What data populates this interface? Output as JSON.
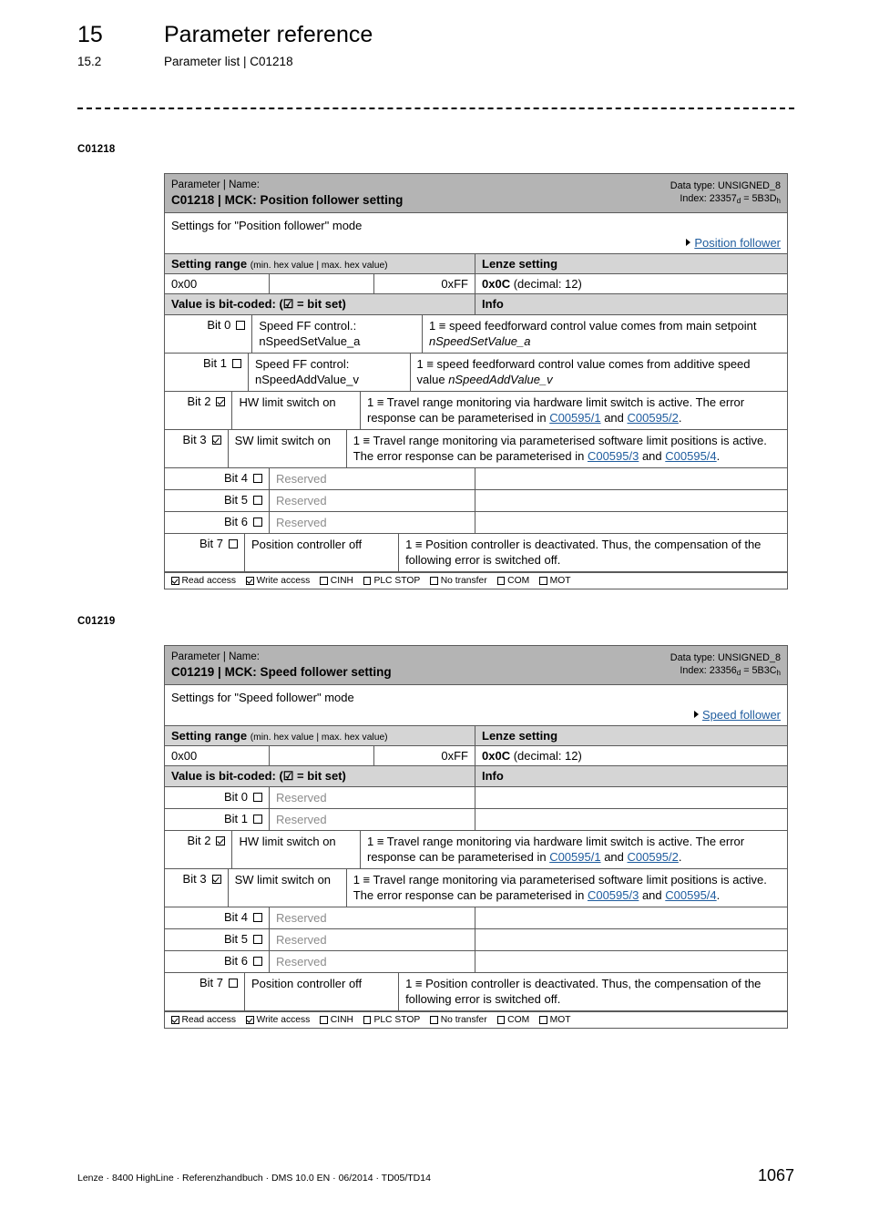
{
  "header": {
    "chapter_number": "15",
    "chapter_title": "Parameter reference",
    "section_number": "15.2",
    "section_title": "Parameter list | C01218"
  },
  "side_labels": {
    "first": "C01218",
    "second": "C01219"
  },
  "footer": {
    "left": "Lenze · 8400 HighLine · Referenzhandbuch · DMS 10.0 EN · 06/2014 · TD05/TD14",
    "page": "1067"
  },
  "common": {
    "kicker": "Parameter | Name:",
    "setting_range_label": "Setting range",
    "setting_range_sub": "(min. hex value | max. hex value)",
    "lenze_setting_label": "Lenze setting",
    "bitcoded_label": "Value is bit-coded:  (☑ = bit set)",
    "info_label": "Info",
    "link_color": "#1f5c9e",
    "header_band_color": "#b4b4b4",
    "section_band_color": "#d5d5d5",
    "access": [
      {
        "label": "Read access",
        "checked": true
      },
      {
        "label": "Write access",
        "checked": true
      },
      {
        "label": "CINH",
        "checked": false
      },
      {
        "label": "PLC STOP",
        "checked": false
      },
      {
        "label": "No transfer",
        "checked": false
      },
      {
        "label": "COM",
        "checked": false
      },
      {
        "label": "MOT",
        "checked": false
      }
    ]
  },
  "tables": [
    {
      "title": "C01218 | MCK: Position follower setting",
      "data_type": "Data type: UNSIGNED_8",
      "index_prefix": "Index: 23357",
      "index_sub_d": "d",
      "index_mid": " = 5B3D",
      "index_sub_h": "h",
      "description": "Settings for \"Position follower\" mode",
      "link": "Position follower",
      "range_min": "0x00",
      "range_mid": "",
      "range_max": "0xFF",
      "lenze_value": "0x0C",
      "lenze_decimal": "(decimal: 12)",
      "bits": [
        {
          "label": "Bit 0",
          "checked": false,
          "name": "Speed FF control.: nSpeedSetValue_a",
          "reserved": false,
          "info_html": "1 ≡ speed feedforward control value comes from main setpoint <i>nSpeedSetValue_a</i>"
        },
        {
          "label": "Bit 1",
          "checked": false,
          "name": "Speed FF control: nSpeedAddValue_v",
          "reserved": false,
          "info_html": "1 ≡ speed feedforward control value comes from additive speed value <i>nSpeedAddValue_v</i>"
        },
        {
          "label": "Bit 2",
          "checked": true,
          "name": "HW limit switch on",
          "reserved": false,
          "info_html": "1 ≡ Travel range monitoring via hardware limit switch is active. The error response can be parameterised in <span class=\"xref\">C00595/1</span> and <span class=\"xref\">C00595/2</span>."
        },
        {
          "label": "Bit 3",
          "checked": true,
          "name": "SW limit switch on",
          "reserved": false,
          "info_html": "1 ≡ Travel range monitoring via parameterised software limit positions is active. The error response can be parameterised in <span class=\"xref\">C00595/3</span> and <span class=\"xref\">C00595/4</span>."
        },
        {
          "label": "Bit 4",
          "checked": false,
          "name": "Reserved",
          "reserved": true,
          "info_html": ""
        },
        {
          "label": "Bit 5",
          "checked": false,
          "name": "Reserved",
          "reserved": true,
          "info_html": ""
        },
        {
          "label": "Bit 6",
          "checked": false,
          "name": "Reserved",
          "reserved": true,
          "info_html": ""
        },
        {
          "label": "Bit 7",
          "checked": false,
          "name": "Position controller off",
          "reserved": false,
          "info_html": "1 ≡ Position controller is deactivated. Thus, the compensation of the following error is switched off."
        }
      ]
    },
    {
      "title": "C01219 | MCK: Speed follower setting",
      "data_type": "Data type: UNSIGNED_8",
      "index_prefix": "Index: 23356",
      "index_sub_d": "d",
      "index_mid": " = 5B3C",
      "index_sub_h": "h",
      "description": "Settings for \"Speed follower\" mode",
      "link": "Speed follower",
      "range_min": "0x00",
      "range_mid": "",
      "range_max": "0xFF",
      "lenze_value": "0x0C",
      "lenze_decimal": "(decimal: 12)",
      "bits": [
        {
          "label": "Bit 0",
          "checked": false,
          "name": "Reserved",
          "reserved": true,
          "info_html": ""
        },
        {
          "label": "Bit 1",
          "checked": false,
          "name": "Reserved",
          "reserved": true,
          "info_html": ""
        },
        {
          "label": "Bit 2",
          "checked": true,
          "name": "HW limit switch on",
          "reserved": false,
          "info_html": "1 ≡ Travel range monitoring via hardware limit switch is active. The error response can be parameterised in <span class=\"xref\">C00595/1</span> and <span class=\"xref\">C00595/2</span>."
        },
        {
          "label": "Bit 3",
          "checked": true,
          "name": "SW limit switch on",
          "reserved": false,
          "info_html": "1 ≡ Travel range monitoring via parameterised software limit positions is active. The error response can be parameterised in <span class=\"xref\">C00595/3</span> and <span class=\"xref\">C00595/4</span>."
        },
        {
          "label": "Bit 4",
          "checked": false,
          "name": "Reserved",
          "reserved": true,
          "info_html": ""
        },
        {
          "label": "Bit 5",
          "checked": false,
          "name": "Reserved",
          "reserved": true,
          "info_html": ""
        },
        {
          "label": "Bit 6",
          "checked": false,
          "name": "Reserved",
          "reserved": true,
          "info_html": ""
        },
        {
          "label": "Bit 7",
          "checked": false,
          "name": "Position controller off",
          "reserved": false,
          "info_html": "1 ≡ Position controller is deactivated. Thus, the compensation of the following error is switched off."
        }
      ]
    }
  ]
}
